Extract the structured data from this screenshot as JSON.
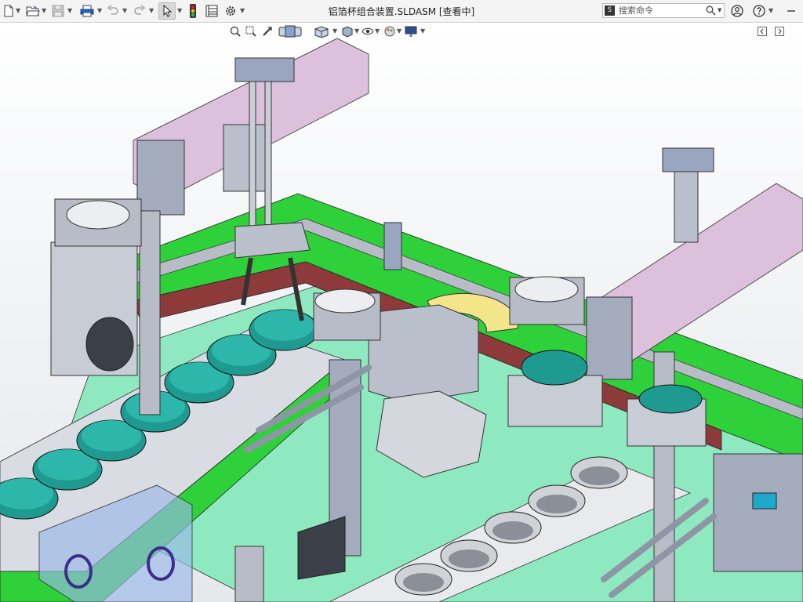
{
  "window": {
    "title": "铝箔杯组合装置.SLDASM [查看中]"
  },
  "toolbar": {
    "items": [
      {
        "icon": "new-document-icon"
      },
      {
        "icon": "open-folder-icon"
      },
      {
        "icon": "save-icon"
      },
      {
        "icon": "print-icon"
      },
      {
        "icon": "undo-icon"
      },
      {
        "icon": "redo-icon"
      },
      {
        "icon": "select-pointer-icon",
        "active": true
      },
      {
        "icon": "rebuild-traffic-light-icon"
      },
      {
        "icon": "file-properties-icon"
      },
      {
        "icon": "options-gear-icon"
      }
    ]
  },
  "search": {
    "prefix": "S",
    "placeholder": "搜索命令"
  },
  "heads_up_toolbar": {
    "items": [
      "zoom-to-fit-icon",
      "zoom-to-area-icon",
      "previous-view-icon",
      "section-view-icon",
      "view-orientation-icon",
      "display-style-icon",
      "hide-show-items-icon",
      "edit-appearance-icon",
      "apply-scene-icon",
      "view-settings-icon"
    ]
  },
  "colors": {
    "background_top": "#ffffff",
    "background_bottom": "#e6e8ec",
    "conveyor_green": "#2fd13a",
    "base_plate_mint": "#8fe9c0",
    "rail_pink": "#dcc0dc",
    "steel_blue": "#9aa6bf",
    "cup_teal": "#1f9a90",
    "cup_silver": "#cfd2d6",
    "guide_yellow": "#f3e68a",
    "belt_maroon": "#8c3a3a",
    "cover_translucent_blue": "#9ab8e8"
  }
}
